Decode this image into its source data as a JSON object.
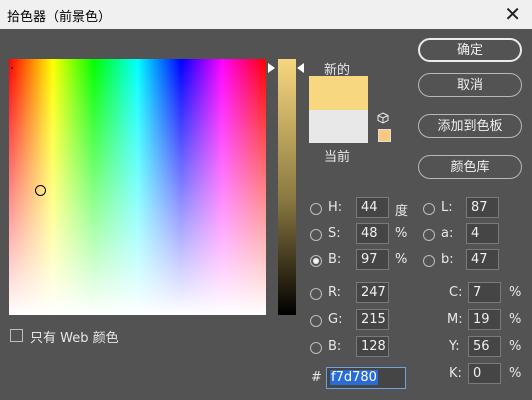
{
  "window": {
    "title": "拾色器（前景色）",
    "close_icon": "close-icon"
  },
  "swatches": {
    "new_label": "新的",
    "current_label": "当前",
    "new_color": "#f7d780",
    "current_color": "#e8e8e8"
  },
  "buttons": {
    "ok": "确定",
    "cancel": "取消",
    "add_to_swatches": "添加到色板",
    "color_libraries": "颜色库"
  },
  "hsb": {
    "h_label": "H:",
    "h_value": "44",
    "h_unit": "度",
    "s_label": "S:",
    "s_value": "48",
    "s_unit": "%",
    "b_label": "B:",
    "b_value": "97",
    "b_unit": "%"
  },
  "lab": {
    "l_label": "L:",
    "l_value": "87",
    "a_label": "a:",
    "a_value": "4",
    "b_label": "b:",
    "b_value": "47"
  },
  "rgb": {
    "r_label": "R:",
    "r_value": "247",
    "g_label": "G:",
    "g_value": "215",
    "b_label": "B:",
    "b_value": "128"
  },
  "cmyk": {
    "c_label": "C:",
    "c_value": "7",
    "c_unit": "%",
    "m_label": "M:",
    "m_value": "19",
    "m_unit": "%",
    "y_label": "Y:",
    "y_value": "56",
    "y_unit": "%",
    "k_label": "K:",
    "k_value": "0",
    "k_unit": "%"
  },
  "hex": {
    "label": "#",
    "value": "f7d780"
  },
  "websafe": {
    "label": "只有 Web 颜色",
    "checked": false
  },
  "selected_mode": "B"
}
